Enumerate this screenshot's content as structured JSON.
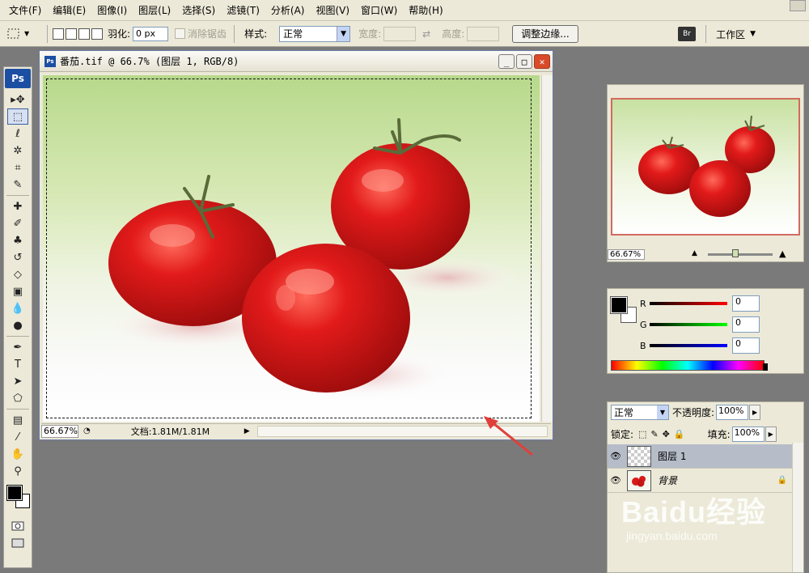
{
  "menu": {
    "items": [
      "文件(F)",
      "编辑(E)",
      "图像(I)",
      "图层(L)",
      "选择(S)",
      "滤镜(T)",
      "分析(A)",
      "视图(V)",
      "窗口(W)",
      "帮助(H)"
    ]
  },
  "options": {
    "feather_label": "羽化:",
    "feather_value": "0 px",
    "antialias_label": "消除锯齿",
    "style_label": "样式:",
    "style_value": "正常",
    "width_label": "宽度:",
    "height_label": "高度:",
    "refine_button": "调整边缘...",
    "workspace_label": "工作区",
    "workspace_icon": "Br"
  },
  "toolbox": {
    "logo": "Ps",
    "tools": [
      {
        "name": "move-tool",
        "glyph": "▸✥"
      },
      {
        "name": "marquee-tool",
        "glyph": "⬚"
      },
      {
        "name": "lasso-tool",
        "glyph": "ℓ"
      },
      {
        "name": "magic-wand-tool",
        "glyph": "✲"
      },
      {
        "name": "crop-tool",
        "glyph": "⌗"
      },
      {
        "name": "slice-tool",
        "glyph": "✎"
      },
      {
        "name": "healing-brush-tool",
        "glyph": "✚"
      },
      {
        "name": "brush-tool",
        "glyph": "✐"
      },
      {
        "name": "clone-stamp-tool",
        "glyph": "♣"
      },
      {
        "name": "history-brush-tool",
        "glyph": "↺"
      },
      {
        "name": "eraser-tool",
        "glyph": "◇"
      },
      {
        "name": "gradient-tool",
        "glyph": "▣"
      },
      {
        "name": "blur-tool",
        "glyph": "💧"
      },
      {
        "name": "dodge-tool",
        "glyph": "●"
      },
      {
        "name": "pen-tool",
        "glyph": "✒"
      },
      {
        "name": "type-tool",
        "glyph": "T"
      },
      {
        "name": "path-selection-tool",
        "glyph": "➤"
      },
      {
        "name": "shape-tool",
        "glyph": "⬠"
      },
      {
        "name": "notes-tool",
        "glyph": "▤"
      },
      {
        "name": "eyedropper-tool",
        "glyph": "⁄"
      },
      {
        "name": "hand-tool",
        "glyph": "✋"
      },
      {
        "name": "zoom-tool",
        "glyph": "⚲"
      }
    ]
  },
  "document": {
    "title": "番茄.tif @ 66.7% (图层 1, RGB/8)",
    "ps_icon": "Ps",
    "status_zoom": "66.67%",
    "status_doc": "文档:1.81M/1.81M"
  },
  "navigator": {
    "zoom": "66.67%"
  },
  "color_panel": {
    "r_label": "R",
    "r_value": "0",
    "g_label": "G",
    "g_value": "0",
    "b_label": "B",
    "b_value": "0",
    "fg_color": "#000000",
    "bg_color": "#ffffff"
  },
  "layers": {
    "blend_mode": "正常",
    "opacity_label": "不透明度:",
    "opacity_value": "100%",
    "lock_label": "锁定:",
    "fill_label": "填充:",
    "fill_value": "100%",
    "items": [
      {
        "name": "图层 1",
        "selected": true,
        "locked": false
      },
      {
        "name": "背景",
        "selected": false,
        "locked": true
      }
    ]
  },
  "watermark": {
    "line1": "Baidu经验",
    "line2": "jingyan.baidu.com"
  },
  "colors": {
    "tomato": "#d91a1a",
    "marquee_border": "#d16a5f",
    "arrow": "#e0403a"
  }
}
